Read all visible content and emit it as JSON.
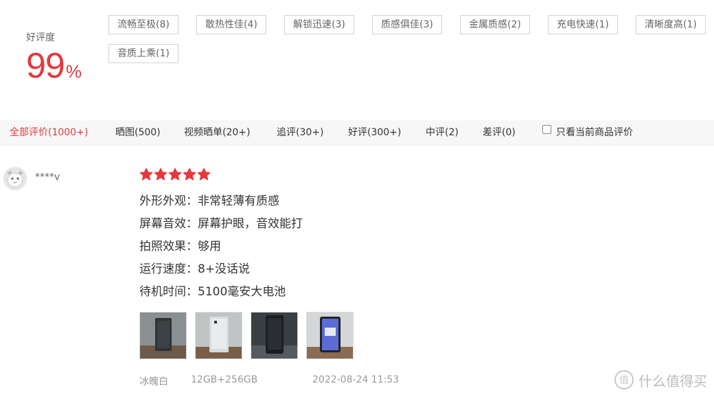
{
  "rating": {
    "label": "好评度",
    "value": "99",
    "unit": "%"
  },
  "tags": [
    "流畅至极(8)",
    "散热性佳(4)",
    "解锁迅速(3)",
    "质感俱佳(3)",
    "金属质感(2)",
    "充电快速(1)",
    "清晰度高(1)",
    "音质上乘(1)"
  ],
  "filters": [
    "全部评价(1000+)",
    "晒图(500)",
    "视频晒单(20+)",
    "追评(30+)",
    "好评(300+)",
    "中评(2)",
    "差评(0)"
  ],
  "only_current": {
    "label": "只看当前商品评价",
    "checked": false
  },
  "review": {
    "username": "****v",
    "stars": 5,
    "lines": [
      "外形外观：非常轻薄有质感",
      "屏幕音效：屏幕护眼，音效能打",
      "拍照效果：够用",
      "运行速度：8+没话说",
      "待机时间：5100毫安大电池"
    ],
    "photos": [
      "photo-1",
      "photo-2",
      "photo-3",
      "photo-4"
    ],
    "color": "冰魄白",
    "spec": "12GB+256GB",
    "date": "2022-08-24 11:53"
  },
  "watermark": {
    "text": "什么值得买",
    "logo": "smzdm-logo"
  },
  "colors": {
    "accent": "#e4393c",
    "star": "#e4393c"
  }
}
